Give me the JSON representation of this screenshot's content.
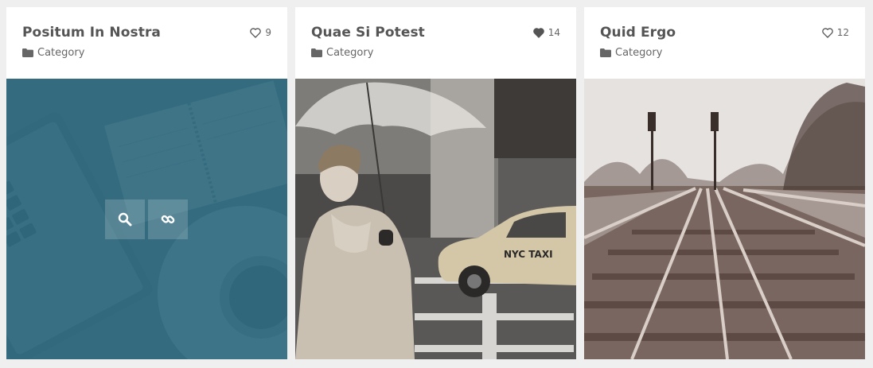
{
  "cards": [
    {
      "title": "Positum In Nostra",
      "category": "Category",
      "likes": "9",
      "liked": false,
      "icon": "heart-outline-icon"
    },
    {
      "title": "Quae Si Potest",
      "category": "Category",
      "likes": "14",
      "liked": true,
      "icon": "heart-filled-icon"
    },
    {
      "title": "Quid Ergo",
      "category": "Category",
      "likes": "12",
      "liked": false,
      "icon": "heart-outline-icon"
    }
  ],
  "overlay": {
    "buttons": [
      "search-icon",
      "link-icon"
    ]
  },
  "colors": {
    "overlay": "#2c687d",
    "text": "#555555",
    "background": "#efefef"
  }
}
